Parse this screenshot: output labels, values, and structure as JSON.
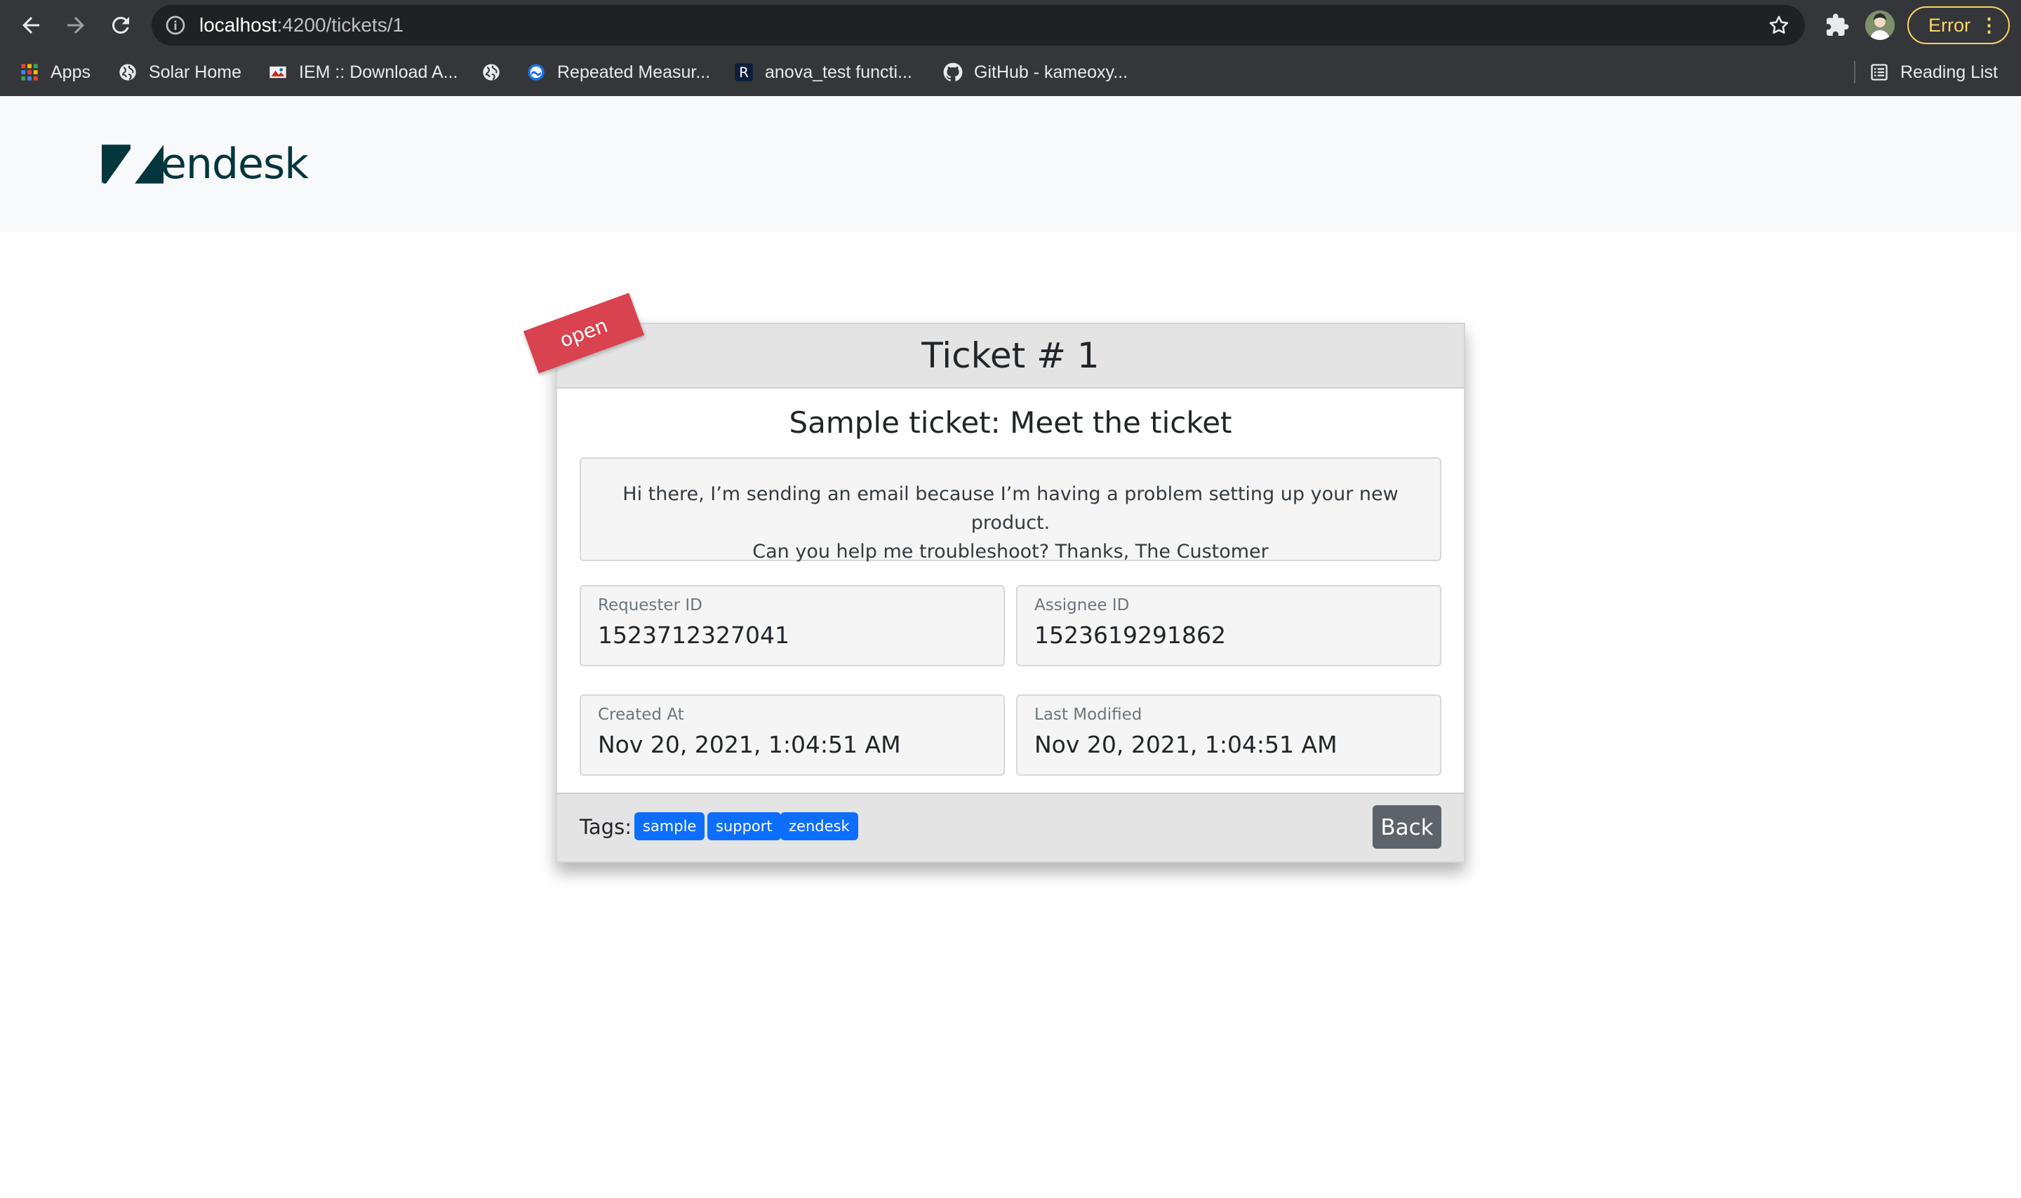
{
  "browser": {
    "url_host": "localhost",
    "url_path": ":4200/tickets/1",
    "error_label": "Error",
    "bookmarks": [
      {
        "label": "Apps",
        "icon": "apps-grid-icon"
      },
      {
        "label": "Solar Home",
        "icon": "globe-icon"
      },
      {
        "label": "IEM :: Download A...",
        "icon": "iem-favicon-icon"
      },
      {
        "label": "",
        "icon": "globe-icon"
      },
      {
        "label": "Repeated Measur...",
        "icon": "repeated-measures-favicon-icon"
      },
      {
        "label": "anova_test functi...",
        "icon": "r-favicon-icon"
      },
      {
        "label": "GitHub - kameoxy...",
        "icon": "github-icon"
      }
    ],
    "reading_list_label": "Reading List"
  },
  "header": {
    "logo_text": "endesk"
  },
  "ticket": {
    "status": "open",
    "title": "Ticket # 1",
    "subject": "Sample ticket: Meet the ticket",
    "description_line1": "Hi there, I’m sending an email because I’m having a problem setting up your new product.",
    "description_line2": "Can you help me troubleshoot? Thanks, The Customer",
    "fields": {
      "requester": {
        "label": "Requester ID",
        "value": "1523712327041"
      },
      "assignee": {
        "label": "Assignee ID",
        "value": "1523619291862"
      },
      "created": {
        "label": "Created At",
        "value": "Nov 20, 2021, 1:04:51 AM"
      },
      "modified": {
        "label": "Last Modified",
        "value": "Nov 20, 2021, 1:04:51 AM"
      }
    },
    "tags_label": "Tags:",
    "tags": [
      "sample",
      "support",
      "zendesk"
    ],
    "back_label": "Back"
  },
  "colors": {
    "brand": "#03363d",
    "status_open": "#d9424f",
    "tag_bg": "#0d6efd",
    "back_btn": "#5c636a",
    "browser_error": "#fdd663"
  }
}
